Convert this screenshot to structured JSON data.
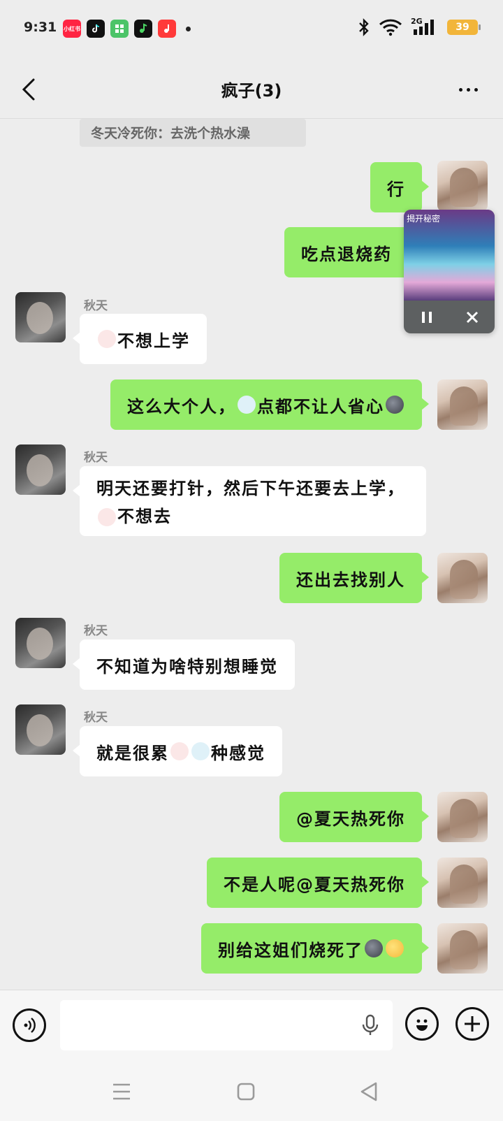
{
  "status_bar": {
    "time": "9:31",
    "app_icons": [
      {
        "name": "xiaohongshu-icon",
        "label": "小红书",
        "color": "#ff2442"
      },
      {
        "name": "tiktok-icon",
        "label": "",
        "color": "#111111"
      },
      {
        "name": "app-grid-icon",
        "label": "",
        "color": "#4cc468"
      },
      {
        "name": "music-app-icon",
        "label": "",
        "color": "#111111"
      },
      {
        "name": "netease-music-icon",
        "label": "",
        "color": "#ff3a3a"
      }
    ],
    "network": "2G",
    "battery": "39"
  },
  "header": {
    "title": "疯子(3)"
  },
  "quote": {
    "text": "冬天冷死你：去洗个热水澡"
  },
  "messages": [
    {
      "side": "me",
      "text": "行"
    },
    {
      "side": "me",
      "text": "吃点退烧药"
    },
    {
      "side": "them",
      "sender": "秋天",
      "text": "不想上学"
    },
    {
      "side": "me",
      "text_a": "这么大个人，",
      "text_b": "点都不让人省心"
    },
    {
      "side": "them",
      "sender": "秋天",
      "text_a": "明天还要打针，然后下午还要去上学，",
      "text_b": "不想去"
    },
    {
      "side": "me",
      "text": "还出去找别人"
    },
    {
      "side": "them",
      "sender": "秋天",
      "text": "不知道为啥特别想睡觉"
    },
    {
      "side": "them",
      "sender": "秋天",
      "text_a": "就是很累",
      "text_b": "种感觉"
    },
    {
      "side": "me",
      "text": "@夏天热死你"
    },
    {
      "side": "me",
      "text": "不是人呢@夏天热死你"
    },
    {
      "side": "me",
      "text": "别给这姐们烧死了"
    }
  ],
  "float_player": {
    "art_caption": "揭开秘密"
  },
  "colors": {
    "my_bubble": "#95ec69",
    "their_bubble": "#ffffff",
    "background": "#ededed"
  }
}
